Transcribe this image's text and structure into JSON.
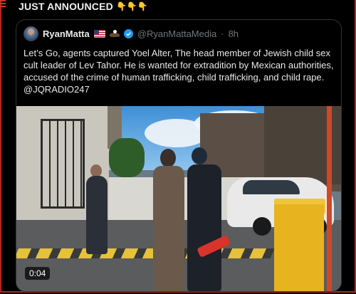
{
  "banner": {
    "text": "JUST ANNOUNCED",
    "emoji": "👇👇👇"
  },
  "post": {
    "author": {
      "name": "RyanMatta",
      "handle": "@RyanMattaMedia",
      "separator": "·",
      "time": "8h",
      "icons": [
        "us-flag-icon",
        "eagle-icon",
        "verified-badge-icon"
      ]
    },
    "text": "Let’s Go, agents captured Yoel Alter, The head member of Jewish child sex cult leader of Lev Tahor. He is wanted for extradition by Mexican authorities, accused of the crime of human trafficking, child trafficking, and child rape. @JQRADIO247",
    "video": {
      "duration": "0:04"
    }
  },
  "colors": {
    "frame": "#b3261e",
    "verified": "#1d9bf0",
    "muted": "#71767b",
    "text": "#e7e9ea"
  }
}
